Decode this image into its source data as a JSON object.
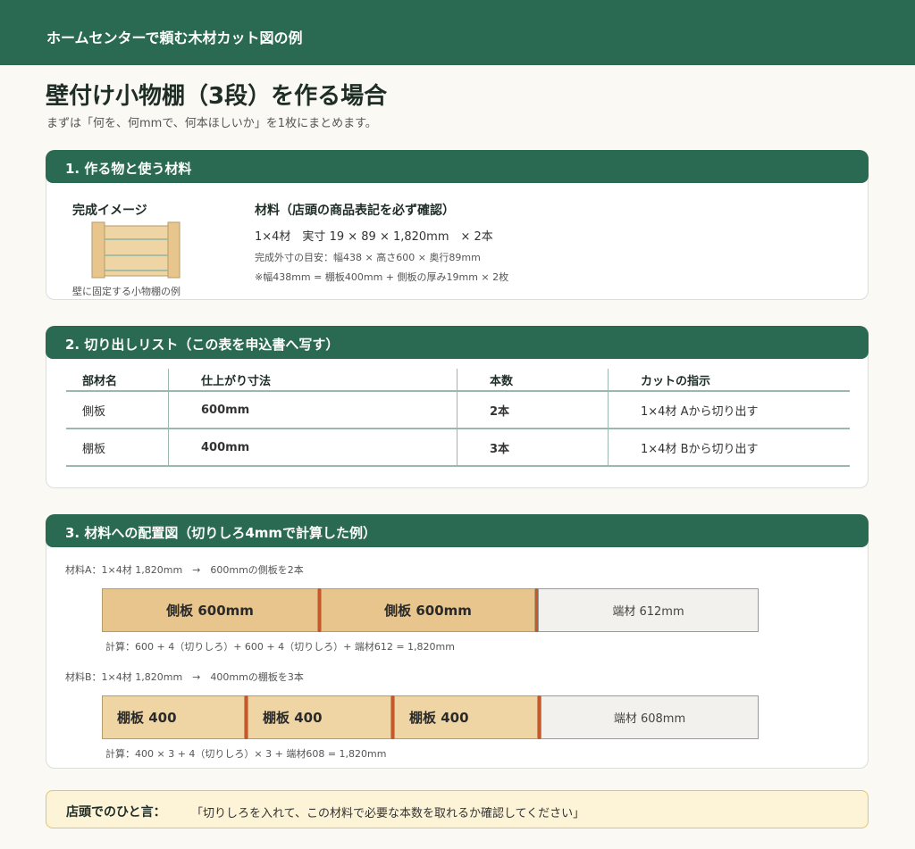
{
  "header": {
    "title": "ホームセンターで頼む木材カット図の例"
  },
  "page": {
    "title": "壁付け小物棚（3段）を作る場合",
    "subtitle": "まずは「何を、何mmで、何本ほしいか」を1枚にまとめます。"
  },
  "section1": {
    "heading": "1. 作る物と使う材料",
    "image_title": "完成イメージ",
    "image_caption": "壁に固定する小物棚の例",
    "material_title": "材料（店頭の商品表記を必ず確認）",
    "material_spec": "1×4材　実寸 19 × 89 × 1,820mm　× 2本",
    "note1": "完成外寸の目安：幅438 × 高さ600 × 奥行89mm",
    "note2": "※幅438mm = 棚板400mm + 側板の厚み19mm × 2枚"
  },
  "section2": {
    "heading": "2. 切り出しリスト（この表を申込書へ写す）",
    "columns": [
      "部材名",
      "仕上がり寸法",
      "本数",
      "カットの指示"
    ],
    "rows": [
      [
        "側板",
        "600mm",
        "2本",
        "1×4材 Aから切り出す"
      ],
      [
        "棚板",
        "400mm",
        "3本",
        "1×4材 Bから切り出す"
      ]
    ]
  },
  "section3": {
    "heading": "3. 材料への配置図（切りしろ4mmで計算した例）",
    "boardA": {
      "label": "材料A：1×4材 1,820mm　→　600mmの側板を2本",
      "pieces": [
        "側板 600mm",
        "側板 600mm"
      ],
      "scrap": "端材 612mm",
      "calc": "計算：600 + 4（切りしろ）+ 600 + 4（切りしろ）+ 端材612 = 1,820mm"
    },
    "boardB": {
      "label": "材料B：1×4材 1,820mm　→　400mmの棚板を3本",
      "pieces": [
        "棚板 400",
        "棚板 400",
        "棚板 400"
      ],
      "scrap": "端材 608mm",
      "calc": "計算：400 × 3 + 4（切りしろ）× 3 + 端材608 = 1,820mm"
    }
  },
  "tip": {
    "label": "店頭でのひと言：",
    "text": "「切りしろを入れて、この材料で必要な本数を取れるか確認してください」"
  },
  "colors": {
    "brand": "#2b6a52",
    "side_board": "#e7c58c",
    "shelf_board": "#efd5a3",
    "kerf": "#c45a2c",
    "scrap": "#f2f1ed",
    "tip_bg": "#fdf3d7"
  }
}
